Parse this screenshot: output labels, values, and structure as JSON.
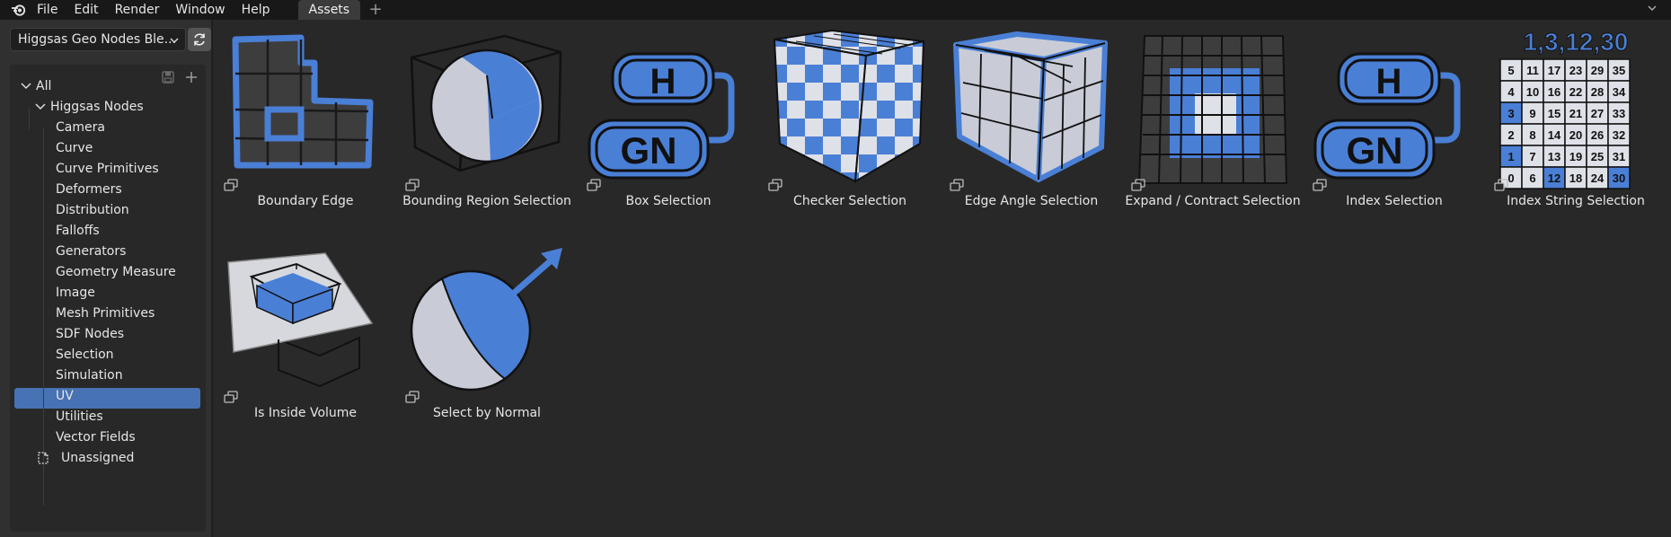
{
  "menubar": {
    "items": [
      "File",
      "Edit",
      "Render",
      "Window",
      "Help"
    ],
    "active_tab": "Assets",
    "add_tab_glyph": "+"
  },
  "library": {
    "selected": "Higgsas Geo Nodes Ble...",
    "refresh_icon": "refresh-icon"
  },
  "tree": {
    "root": "All",
    "group": "Higgsas Nodes",
    "items": [
      "Camera",
      "Curve",
      "Curve Primitives",
      "Deformers",
      "Distribution",
      "Falloffs",
      "Generators",
      "Geometry Measure",
      "Image",
      "Mesh Primitives",
      "SDF Nodes",
      "Selection",
      "Simulation",
      "UV",
      "Utilities",
      "Vector Fields"
    ],
    "selected_item": "Selection",
    "unassigned": "Unassigned"
  },
  "assets": [
    {
      "name": "Boundary Edge",
      "icon": "boundary-edge-thumb"
    },
    {
      "name": "Bounding Region Selection",
      "icon": "bounding-region-thumb"
    },
    {
      "name": "Box Selection",
      "icon": "hgn-logo-thumb"
    },
    {
      "name": "Checker Selection",
      "icon": "checker-cube-thumb"
    },
    {
      "name": "Edge Angle Selection",
      "icon": "edge-angle-cube-thumb"
    },
    {
      "name": "Expand / Contract Selection",
      "icon": "expand-contract-grid-thumb"
    },
    {
      "name": "Index Selection",
      "icon": "hgn-logo-thumb"
    },
    {
      "name": "Index String Selection",
      "icon": "index-string-grid-thumb"
    },
    {
      "name": "Is Inside Volume",
      "icon": "inside-volume-thumb"
    },
    {
      "name": "Select by Normal",
      "icon": "normal-sphere-thumb"
    }
  ],
  "index_string": {
    "header": "1,3,12,30",
    "grid": [
      [
        "5",
        "11",
        "17",
        "23",
        "29",
        "35"
      ],
      [
        "4",
        "10",
        "16",
        "22",
        "28",
        "34"
      ],
      [
        "3",
        "9",
        "15",
        "21",
        "27",
        "33"
      ],
      [
        "2",
        "8",
        "14",
        "20",
        "26",
        "32"
      ],
      [
        "1",
        "7",
        "13",
        "19",
        "25",
        "31"
      ],
      [
        "0",
        "6",
        "12",
        "18",
        "24",
        "30"
      ]
    ],
    "highlighted": [
      "1",
      "3",
      "12",
      "30"
    ]
  },
  "logo_text": {
    "top": "H",
    "bottom": "GN"
  },
  "colors": {
    "accent": "#4772b3",
    "asset_blue": "#4a7fd6",
    "background": "#282828",
    "panel": "#303030"
  }
}
